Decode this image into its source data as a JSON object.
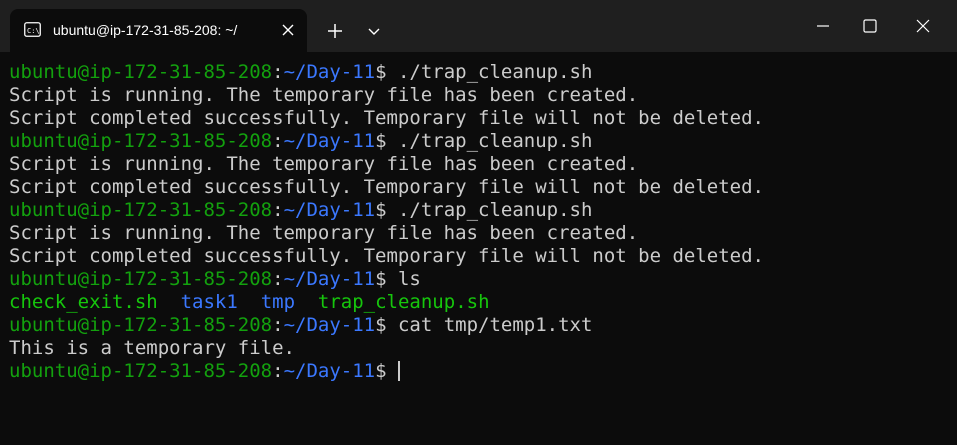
{
  "window": {
    "tab_title": "ubuntu@ip-172-31-85-208: ~/",
    "tab_icon": "terminal-icon",
    "new_tab_icon": "plus-icon",
    "dropdown_icon": "chevron-down-icon",
    "minimize_icon": "minimize-icon",
    "maximize_icon": "maximize-icon",
    "close_icon": "close-icon"
  },
  "colors": {
    "background": "#0c0c0c",
    "titlebar": "#1f1f1f",
    "text": "#cccccc",
    "user": "#13a10e",
    "path": "#3b78ff",
    "executable": "#16c60c",
    "directory": "#3b78ff"
  },
  "terminal": {
    "user": "ubuntu@ip-172-31-85-208",
    "separator": ":",
    "path": "~/Day-11",
    "prompt_symbol": "$",
    "lines": [
      {
        "type": "prompt",
        "command": " ./trap_cleanup.sh"
      },
      {
        "type": "output",
        "text": "Script is running. The temporary file has been created."
      },
      {
        "type": "output",
        "text": "Script completed successfully. Temporary file will not be deleted."
      },
      {
        "type": "prompt",
        "command": " ./trap_cleanup.sh"
      },
      {
        "type": "output",
        "text": "Script is running. The temporary file has been created."
      },
      {
        "type": "output",
        "text": "Script completed successfully. Temporary file will not be deleted."
      },
      {
        "type": "prompt",
        "command": " ./trap_cleanup.sh"
      },
      {
        "type": "output",
        "text": "Script is running. The temporary file has been created."
      },
      {
        "type": "output",
        "text": "Script completed successfully. Temporary file will not be deleted."
      },
      {
        "type": "prompt",
        "command": " ls"
      },
      {
        "type": "listing",
        "items": [
          {
            "name": "check_exit.sh",
            "kind": "executable"
          },
          {
            "name": "task1",
            "kind": "directory"
          },
          {
            "name": "tmp",
            "kind": "directory"
          },
          {
            "name": "trap_cleanup.sh",
            "kind": "executable"
          }
        ]
      },
      {
        "type": "prompt",
        "command": " cat tmp/temp1.txt"
      },
      {
        "type": "output",
        "text": "This is a temporary file."
      },
      {
        "type": "prompt",
        "command": " ",
        "cursor": true
      }
    ]
  }
}
